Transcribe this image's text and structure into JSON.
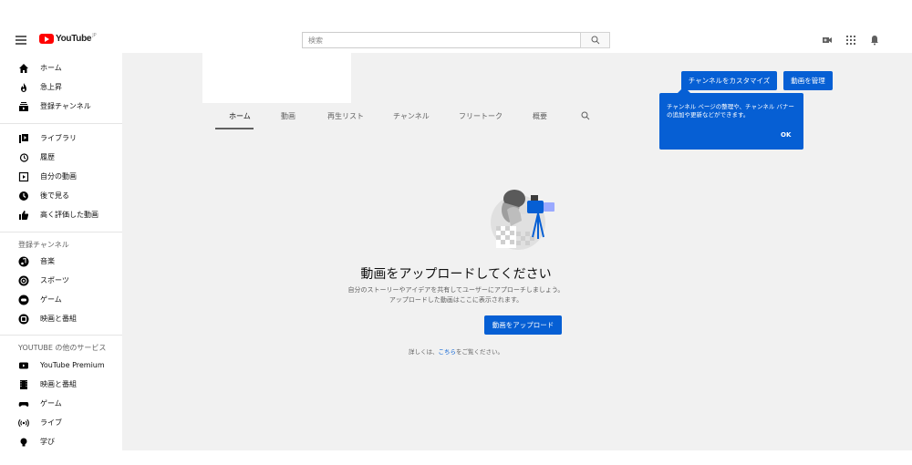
{
  "header": {
    "logo_text": "YouTube",
    "logo_sup": "JP",
    "search_placeholder": "検索"
  },
  "sidebar": {
    "main_items": [
      {
        "label": "ホーム",
        "icon": "home-icon"
      },
      {
        "label": "急上昇",
        "icon": "flame-icon"
      },
      {
        "label": "登録チャンネル",
        "icon": "subscriptions-icon"
      }
    ],
    "library_items": [
      {
        "label": "ライブラリ",
        "icon": "library-icon"
      },
      {
        "label": "履歴",
        "icon": "history-icon"
      },
      {
        "label": "自分の動画",
        "icon": "my-videos-icon"
      },
      {
        "label": "後で見る",
        "icon": "watch-later-icon"
      },
      {
        "label": "高く評価した動画",
        "icon": "thumbs-up-icon"
      }
    ],
    "subs_heading": "登録チャンネル",
    "subs_items": [
      {
        "label": "音楽",
        "icon": "music-channel-icon"
      },
      {
        "label": "スポーツ",
        "icon": "sports-channel-icon"
      },
      {
        "label": "ゲーム",
        "icon": "gaming-channel-icon"
      },
      {
        "label": "映画と番組",
        "icon": "movies-channel-icon"
      }
    ],
    "services_heading": "YOUTUBE の他のサービス",
    "services_items": [
      {
        "label": "YouTube Premium",
        "icon": "youtube-premium-icon"
      },
      {
        "label": "映画と番組",
        "icon": "film-icon"
      },
      {
        "label": "ゲーム",
        "icon": "gamepad-icon"
      },
      {
        "label": "ライブ",
        "icon": "live-icon"
      },
      {
        "label": "学び",
        "icon": "lightbulb-icon"
      }
    ]
  },
  "channel": {
    "tabs": [
      "ホーム",
      "動画",
      "再生リスト",
      "チャンネル",
      "フリートーク",
      "概要"
    ],
    "active_tab": "ホーム",
    "customize_button": "チャンネルをカスタマイズ",
    "manage_button": "動画を管理",
    "tooltip_text": "チャンネル ページの整理や、チャンネル バナーの追加や更新などができます。",
    "tooltip_ok": "OK"
  },
  "empty_state": {
    "title": "動画をアップロードしてください",
    "desc_line1": "自分のストーリーやアイデアを共有してユーザーにアプローチしましょう。",
    "desc_line2": "アップロードした動画はここに表示されます。",
    "upload_button": "動画をアップロード",
    "more_prefix": "詳しくは、",
    "more_link": "こちら",
    "more_suffix": "をご覧ください。"
  },
  "colors": {
    "accent": "#065fd4",
    "logo_red": "#ff0000",
    "main_bg": "#f1f1f1"
  }
}
